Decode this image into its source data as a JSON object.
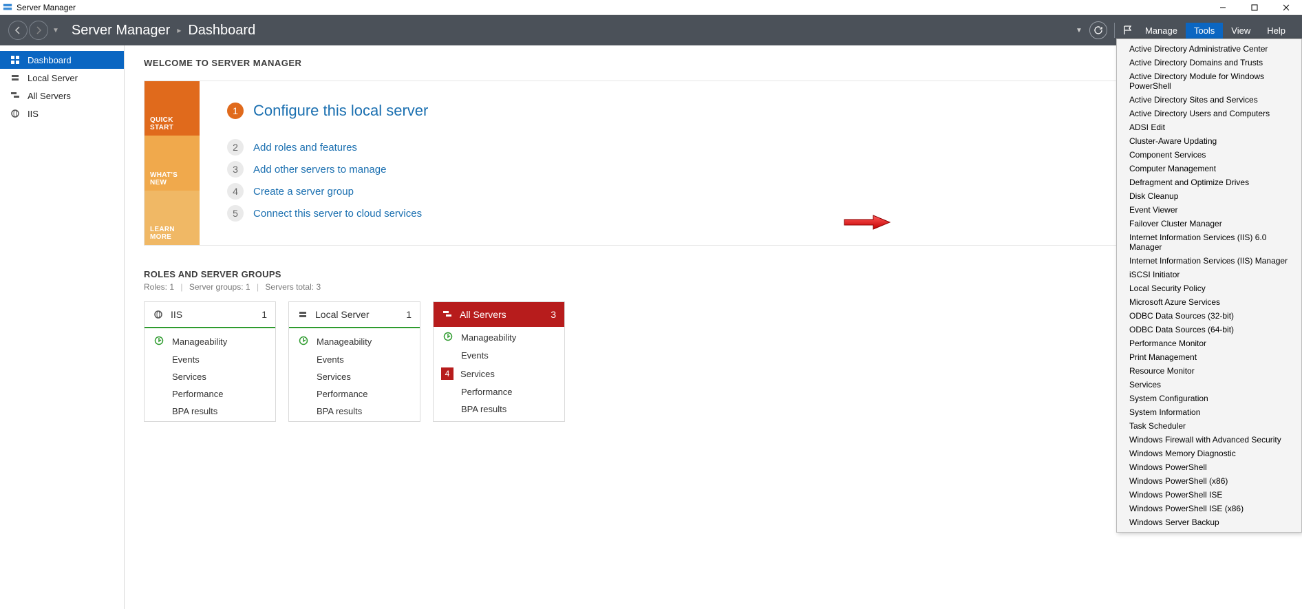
{
  "titlebar": {
    "title": "Server Manager"
  },
  "breadcrumb": {
    "app": "Server Manager",
    "page": "Dashboard"
  },
  "menu": {
    "manage": "Manage",
    "tools": "Tools",
    "view": "View",
    "help": "Help"
  },
  "sidebar": {
    "items": [
      {
        "label": "Dashboard",
        "icon": "dashboard"
      },
      {
        "label": "Local Server",
        "icon": "server"
      },
      {
        "label": "All Servers",
        "icon": "servers"
      },
      {
        "label": "IIS",
        "icon": "iis"
      }
    ]
  },
  "welcome": {
    "heading": "WELCOME TO SERVER MANAGER",
    "blocks": {
      "quickstart": "QUICK START",
      "whatsnew": "WHAT'S NEW",
      "learnmore": "LEARN MORE"
    },
    "steps": [
      {
        "n": "1",
        "label": "Configure this local server"
      },
      {
        "n": "2",
        "label": "Add roles and features"
      },
      {
        "n": "3",
        "label": "Add other servers to manage"
      },
      {
        "n": "4",
        "label": "Create a server group"
      },
      {
        "n": "5",
        "label": "Connect this server to cloud services"
      }
    ]
  },
  "groups": {
    "heading": "ROLES AND SERVER GROUPS",
    "sub": {
      "roles_label": "Roles:",
      "roles": "1",
      "sg_label": "Server groups:",
      "sg": "1",
      "st_label": "Servers total:",
      "st": "3"
    },
    "tiles": [
      {
        "title": "IIS",
        "count": "1"
      },
      {
        "title": "Local Server",
        "count": "1"
      },
      {
        "title": "All Servers",
        "count": "3"
      }
    ],
    "rows": {
      "manageability": "Manageability",
      "events": "Events",
      "services": "Services",
      "performance": "Performance",
      "bpa": "BPA results"
    },
    "alert_count": "4"
  },
  "tools_menu": [
    "Active Directory Administrative Center",
    "Active Directory Domains and Trusts",
    "Active Directory Module for Windows PowerShell",
    "Active Directory Sites and Services",
    "Active Directory Users and Computers",
    "ADSI Edit",
    "Cluster-Aware Updating",
    "Component Services",
    "Computer Management",
    "Defragment and Optimize Drives",
    "Disk Cleanup",
    "Event Viewer",
    "Failover Cluster Manager",
    "Internet Information Services (IIS) 6.0 Manager",
    "Internet Information Services (IIS) Manager",
    "iSCSI Initiator",
    "Local Security Policy",
    "Microsoft Azure Services",
    "ODBC Data Sources (32-bit)",
    "ODBC Data Sources (64-bit)",
    "Performance Monitor",
    "Print Management",
    "Resource Monitor",
    "Services",
    "System Configuration",
    "System Information",
    "Task Scheduler",
    "Windows Firewall with Advanced Security",
    "Windows Memory Diagnostic",
    "Windows PowerShell",
    "Windows PowerShell (x86)",
    "Windows PowerShell ISE",
    "Windows PowerShell ISE (x86)",
    "Windows Server Backup"
  ]
}
